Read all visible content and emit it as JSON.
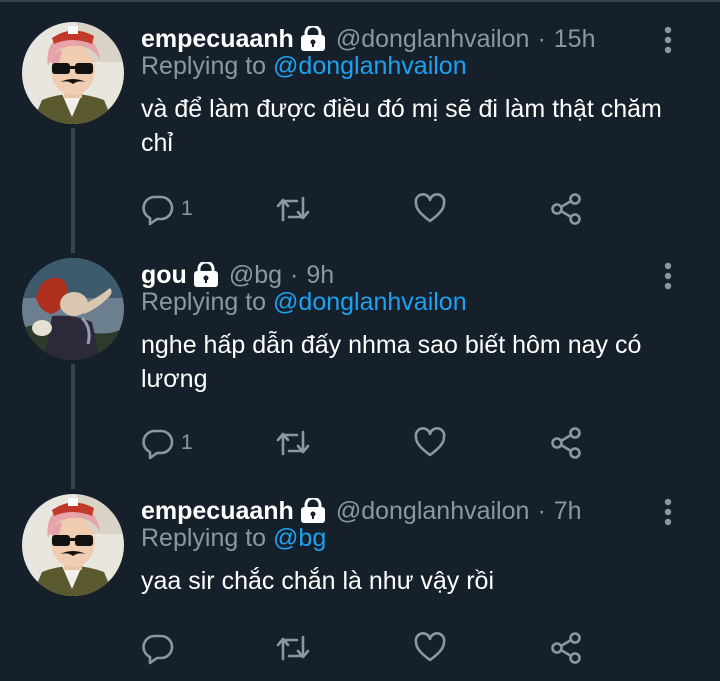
{
  "tweets": [
    {
      "name": "empecuaanh",
      "handle": "@donglanhvailon",
      "separator": "·",
      "time": "15h",
      "replying_prefix": "Replying to",
      "replying_to": "@donglanhvailon",
      "text": "và để làm được điều đó mị sẽ đi làm thật chăm chỉ",
      "reply_count": "1",
      "retweet_count": "",
      "like_count": "",
      "avatar_icon": "avatar-pink-hair-sunglasses"
    },
    {
      "name": "gou",
      "handle": "@bg",
      "separator": "·",
      "time": "9h",
      "replying_prefix": "Replying to",
      "replying_to": "@donglanhvailon",
      "text": "nghe hấp dẫn đấy nhma sao biết hôm nay có lương",
      "reply_count": "1",
      "retweet_count": "",
      "like_count": "",
      "avatar_icon": "avatar-cartoon-witch"
    },
    {
      "name": "empecuaanh",
      "handle": "@donglanhvailon",
      "separator": "·",
      "time": "7h",
      "replying_prefix": "Replying to",
      "replying_to": "@bg",
      "text": "yaa sir chắc chắn là như vậy rồi",
      "reply_count": "",
      "retweet_count": "",
      "like_count": "",
      "avatar_icon": "avatar-pink-hair-sunglasses"
    }
  ],
  "colors": {
    "background": "#15202b",
    "secondary_text": "#8899a6",
    "mention": "#1da1f2",
    "divider": "#38444d"
  },
  "icons": {
    "protected": "lock-icon",
    "more": "more-vertical-icon",
    "reply": "reply-icon",
    "retweet": "retweet-icon",
    "like": "heart-icon",
    "share": "share-icon"
  }
}
